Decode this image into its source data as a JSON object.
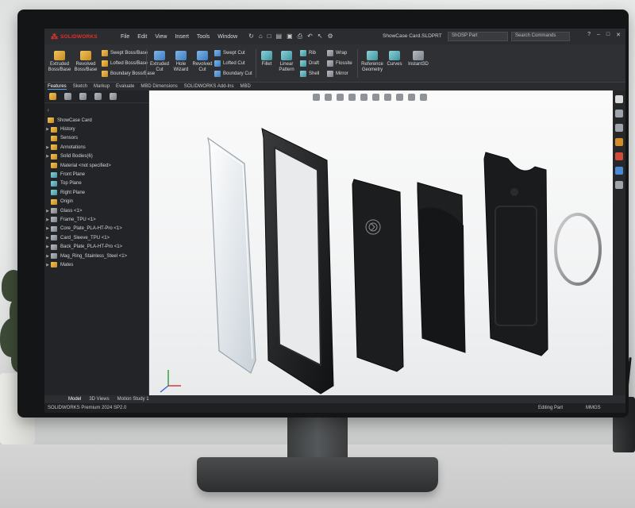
{
  "app": {
    "brand": "SOLIDWORKS",
    "menu": [
      "File",
      "Edit",
      "View",
      "Insert",
      "Tools",
      "Window"
    ],
    "document_title": "ShowCase Card.SLDPRT",
    "filter_text": "ShOSP Part",
    "search_placeholder": "Search Commands"
  },
  "ribbon": {
    "extruded_boss": "Extruded\nBoss/Base",
    "revolved_boss": "Revolved\nBoss/Base",
    "swept_boss": "Swept Boss/Base",
    "lofted_boss": "Lofted Boss/Base",
    "boundary_boss": "Boundary Boss/Base",
    "extruded_cut": "Extruded\nCut",
    "hole_wizard": "Hole\nWizard",
    "revolved_cut": "Revolved\nCut",
    "swept_cut": "Swept Cut",
    "lofted_cut": "Lofted Cut",
    "boundary_cut": "Boundary Cut",
    "fillet": "Fillet",
    "linear_pattern": "Linear\nPattern",
    "rib": "Rib",
    "draft": "Draft",
    "shell": "Shell",
    "wrap": "Wrap",
    "intersect": "Flossite",
    "mirror": "Mirror",
    "reference_geometry": "Reference\nGeometry",
    "curves": "Curves",
    "instant3d": "Instant3D"
  },
  "command_tabs": [
    "Features",
    "Sketch",
    "Markup",
    "Evaluate",
    "MBD Dimensions",
    "SOLIDWORKS Add-Ins",
    "MBD"
  ],
  "feature_tree": {
    "root": "ShowCase Card",
    "items": [
      {
        "label": "History",
        "expand": true,
        "icon": "folder-icon"
      },
      {
        "label": "Sensors",
        "expand": false,
        "icon": "folder-icon"
      },
      {
        "label": "Annotations",
        "expand": true,
        "icon": "annotation-icon"
      },
      {
        "label": "Solid Bodies(6)",
        "expand": true,
        "icon": "folder-icon"
      },
      {
        "label": "Material <not specified>",
        "expand": false,
        "icon": "material-icon"
      },
      {
        "label": "Front Plane",
        "expand": false,
        "icon": "plane-icon"
      },
      {
        "label": "Top Plane",
        "expand": false,
        "icon": "plane-icon"
      },
      {
        "label": "Right Plane",
        "expand": false,
        "icon": "plane-icon"
      },
      {
        "label": "Origin",
        "expand": false,
        "icon": "origin-icon"
      },
      {
        "label": "Glass <1>",
        "expand": true,
        "icon": "part-icon"
      },
      {
        "label": "Frame_TPU <1>",
        "expand": true,
        "icon": "part-icon"
      },
      {
        "label": "Core_Plate_PLA-HT-Pro <1>",
        "expand": true,
        "icon": "part-icon"
      },
      {
        "label": "Card_Sleeve_TPU <1>",
        "expand": true,
        "icon": "part-icon"
      },
      {
        "label": "Back_Plate_PLA-HT-Pro <1>",
        "expand": true,
        "icon": "part-icon"
      },
      {
        "label": "Mag_Ring_Stainless_Steel <1>",
        "expand": true,
        "icon": "part-icon"
      },
      {
        "label": "Mates",
        "expand": true,
        "icon": "folder-icon"
      }
    ]
  },
  "bottom_tabs": [
    "Model",
    "3D Views",
    "Motion Study 1"
  ],
  "active_bottom_tab": "Model",
  "status": {
    "version": "SOLIDWORKS Premium 2024 SP2.0",
    "mode": "Editing Part",
    "units": "MMGS"
  },
  "colors": {
    "brand_red": "#e0322c",
    "accent_blue": "#5aa0e0",
    "chrome_dark": "#2b2c2f"
  }
}
